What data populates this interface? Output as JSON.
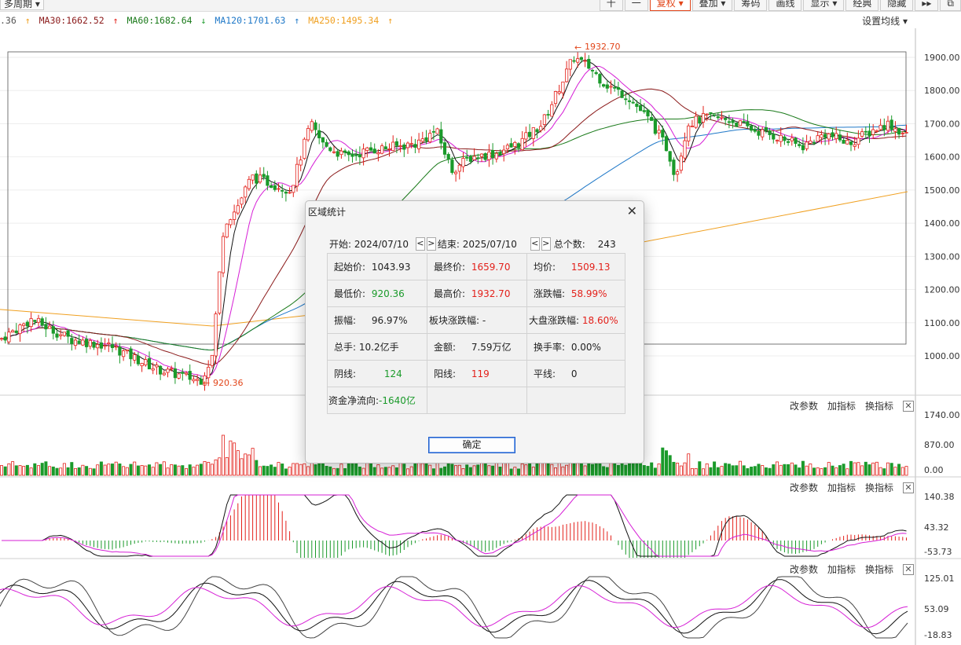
{
  "toolbar": {
    "period_label": "多周期",
    "buttons": [
      {
        "label": "十"
      },
      {
        "label": "一"
      },
      {
        "label": "复权"
      },
      {
        "label": "叠加"
      },
      {
        "label": "筹码"
      },
      {
        "label": "画线"
      },
      {
        "label": "显示"
      },
      {
        "label": "经典"
      },
      {
        "label": "隐藏"
      }
    ],
    "expand_icon": "double-chevron-right-icon",
    "restore_icon": "restore-window-icon"
  },
  "ma_legend": [
    {
      "text": ".36",
      "color": "#333333"
    },
    {
      "text": "MA30:1662.52",
      "color": "#8b1a1a"
    },
    {
      "text": "MA60:1682.64",
      "color": "#1a7a1a"
    },
    {
      "text": "MA120:1701.63",
      "color": "#1f78c8"
    },
    {
      "text": "MA250:1495.34",
      "color": "#f0a020"
    }
  ],
  "set_ma_label": "设置均线",
  "price_axis": [
    "1900.00",
    "1800.00",
    "1700.00",
    "1600.00",
    "1500.00",
    "1400.00",
    "1300.00",
    "1200.00",
    "1100.00",
    "1000.00"
  ],
  "annotations": {
    "high": "1932.70",
    "low": "920.36"
  },
  "panel_tools": {
    "change_params": "改参数",
    "add_indicator": "加指标",
    "swap_indicator": "换指标"
  },
  "volume_axis": [
    "1740.00",
    "870.00",
    "0.00"
  ],
  "macd_axis": [
    "140.38",
    "43.32",
    "-53.73"
  ],
  "kdj_axis": [
    "125.01",
    "53.09",
    "-18.83"
  ],
  "colors": {
    "up": "#e3201a",
    "down": "#1a9a2a",
    "accent": "#e2461a"
  },
  "dialog": {
    "title": "区域统计",
    "start_label": "开始:",
    "start_date": "2024/07/10",
    "prev_label": "<",
    "next_label": ">",
    "end_label": "结束:",
    "end_date": "2025/07/10",
    "total_label": "总个数:",
    "total_count": "243",
    "cells": {
      "open_label": "起始价:",
      "open_value": "1043.93",
      "close_label": "最终价:",
      "close_value": "1659.70",
      "avg_label": "均价:",
      "avg_value": "1509.13",
      "low_label": "最低价:",
      "low_value": "920.36",
      "high_label": "最高价:",
      "high_value": "1932.70",
      "chg_label": "涨跌幅:",
      "chg_value": "58.99%",
      "amp_label": "振幅:",
      "amp_value": "96.97%",
      "sector_label": "板块涨跌幅:",
      "sector_value": "-",
      "market_label": "大盘涨跌幅:",
      "market_value": "18.60%",
      "vol_label": "总手:",
      "vol_value": "10.2亿手",
      "amount_label": "金额:",
      "amount_value": "7.59万亿",
      "turnover_label": "换手率:",
      "turnover_value": "0.00%",
      "neg_label": "阴线:",
      "neg_value": "124",
      "pos_label": "阳线:",
      "pos_value": "119",
      "flat_label": "平线:",
      "flat_value": "0",
      "netflow_label": "资金净流向:",
      "netflow_value": "-1640亿"
    },
    "ok_label": "确定",
    "close_icon": "close-icon"
  }
}
